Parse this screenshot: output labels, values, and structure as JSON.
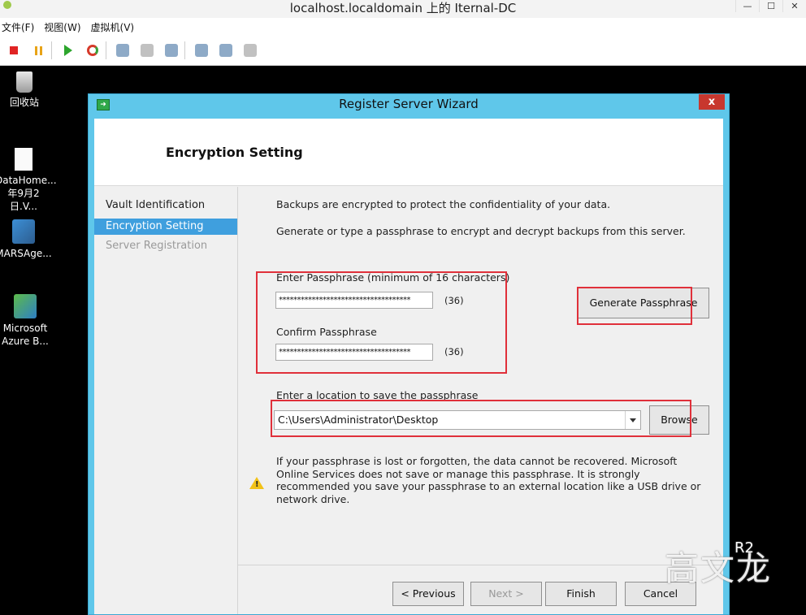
{
  "host": {
    "title": "localhost.localdomain 上的 Iternal-DC",
    "menu": [
      "文件(F)",
      "视图(W)",
      "虚拟机(V)"
    ],
    "window_controls": {
      "minimize": "—",
      "maximize": "☐",
      "close": "✕"
    }
  },
  "desktop": {
    "icons": [
      {
        "label": "回收站",
        "icon": "recycle-bin-icon"
      },
      {
        "label": "DataHome...",
        "label2": "年9月2日.V...",
        "icon": "document-icon"
      },
      {
        "label": "MARSAge...",
        "icon": "mars-agent-icon"
      },
      {
        "label": "Microsoft",
        "label2": "Azure B...",
        "icon": "azure-backup-icon"
      }
    ]
  },
  "dialog": {
    "title": "Register Server Wizard",
    "icon_glyph": "➜",
    "close_glyph": "x",
    "header": "Encryption Setting",
    "nav": [
      {
        "label": "Vault Identification",
        "state": "normal"
      },
      {
        "label": "Encryption Setting",
        "state": "active"
      },
      {
        "label": "Server Registration",
        "state": "disabled"
      }
    ],
    "intro1": "Backups are encrypted to protect the confidentiality of your data.",
    "intro2": "Generate or type a passphrase to encrypt and decrypt backups from this server.",
    "passphrase_label": "Enter Passphrase (minimum of 16 characters)",
    "passphrase_value": "************************************",
    "passphrase_count": "(36)",
    "confirm_label": "Confirm Passphrase",
    "confirm_value": "************************************",
    "confirm_count": "(36)",
    "generate_button": "Generate Passphrase",
    "location_label": "Enter a location to save the passphrase",
    "location_value": "C:\\Users\\Administrator\\Desktop",
    "browse_button": "Browse",
    "warning_lines": [
      "If your passphrase is lost or forgotten, the data cannot be recovered. Microsoft",
      "Online Services does not save or manage this passphrase. It is strongly",
      "recommended you save your passphrase to an external location like a USB drive or",
      "network drive."
    ],
    "footer_buttons": {
      "previous": "< Previous",
      "next": "Next >",
      "finish": "Finish",
      "cancel": "Cancel"
    }
  },
  "watermark": {
    "text": "高文龙",
    "superscript": "R2"
  },
  "colors": {
    "dialog_frame": "#5fc7ea",
    "nav_active": "#3f9fde",
    "highlight_box": "#e0303a"
  }
}
